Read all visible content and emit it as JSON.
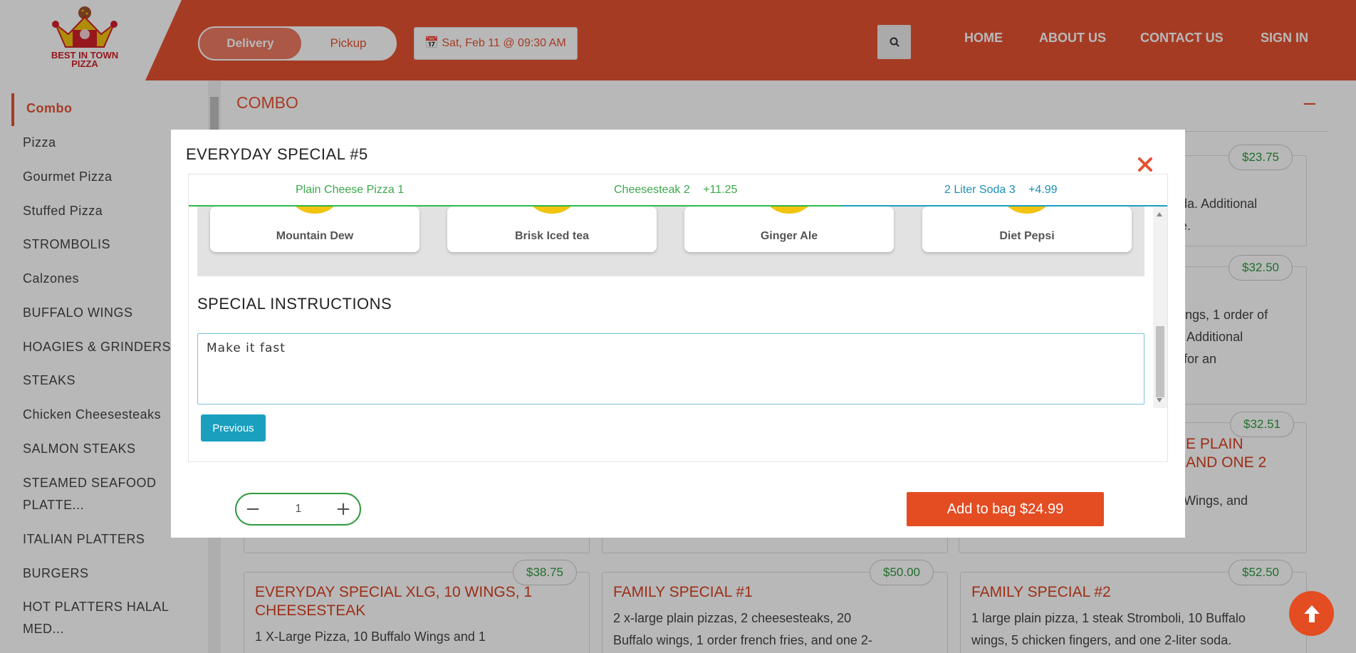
{
  "header": {
    "logo_text": "BEST IN TOWN PIZZA",
    "delivery_label": "Delivery",
    "pickup_label": "Pickup",
    "datetime": "Sat, Feb 11 @ 09:30 AM",
    "nav": [
      "HOME",
      "ABOUT US",
      "CONTACT US",
      "SIGN IN"
    ]
  },
  "sidebar": {
    "items": [
      "Combo",
      "Pizza",
      "Gourmet Pizza",
      "Stuffed Pizza",
      "STROMBOLIS",
      "Calzones",
      "BUFFALO WINGS",
      "HOAGIES & GRINDERS",
      "STEAKS",
      "Chicken Cheesesteaks",
      "SALMON STEAKS",
      "STEAMED SEAFOOD",
      "PLATTE...",
      "ITALIAN PLATTERS",
      "BURGERS",
      "HOT PLATTERS HALAL",
      "MED..."
    ],
    "active": "Combo"
  },
  "main": {
    "section_title": "COMBO",
    "collapse_symbol": "−",
    "cards_partial": [
      {
        "price": "$23.75",
        "desc_line1": "oda. Additional",
        "desc_line2": "ge."
      },
      {
        "price": "$32.50",
        "desc_line1": "wings, 1 order of",
        "desc_line2": "a. Additional",
        "desc_line3": "e for an"
      },
      {
        "price": "$32.51",
        "title_line1": "E PLAIN",
        "title_line2": "AND ONE 2",
        "desc_line1": "o Wings, and"
      }
    ],
    "cards": [
      {
        "price": "$38.75",
        "title_line1": "EVERYDAY SPECIAL XLG, 10 WINGS, 1",
        "title_line2": "CHEESESTEAK",
        "desc_line1": "1 X-Large Pizza, 10 Buffalo Wings and 1"
      },
      {
        "price": "$50.00",
        "title_line1": "FAMILY SPECIAL #1",
        "desc_line1": "2 x-large plain pizzas, 2 cheesesteaks, 20",
        "desc_line2": "Buffalo wings, 1 order french fries, and one 2-"
      },
      {
        "price": "$52.50",
        "title_line1": "FAMILY SPECIAL #2",
        "desc_line1": "1 large plain pizza, 1 steak Stromboli, 10 Buffalo",
        "desc_line2": "wings, 5 chicken fingers, and one 2-liter soda."
      }
    ]
  },
  "modal": {
    "title": "EVERYDAY SPECIAL #5",
    "steps": [
      {
        "label": "Plain Cheese Pizza 1",
        "extra": "",
        "color": "#3aa84a"
      },
      {
        "label": "Cheesesteak 2",
        "extra": "+11.25",
        "color": "#3aa84a"
      },
      {
        "label": "2 Liter Soda 3",
        "extra": "+4.99",
        "color": "#1a8fb5"
      }
    ],
    "drinks": [
      "Mountain Dew",
      "Brisk Iced tea",
      "Ginger Ale",
      "Diet Pepsi"
    ],
    "special_instructions_title": "SPECIAL INSTRUCTIONS",
    "special_instructions_value": "Make it fast",
    "previous_label": "Previous",
    "quantity": "1",
    "add_to_bag_label": "Add to bag $24.99"
  },
  "colors": {
    "brand": "#e65232",
    "price_green": "#2f9a40",
    "step_blue": "#1a9fbf"
  }
}
